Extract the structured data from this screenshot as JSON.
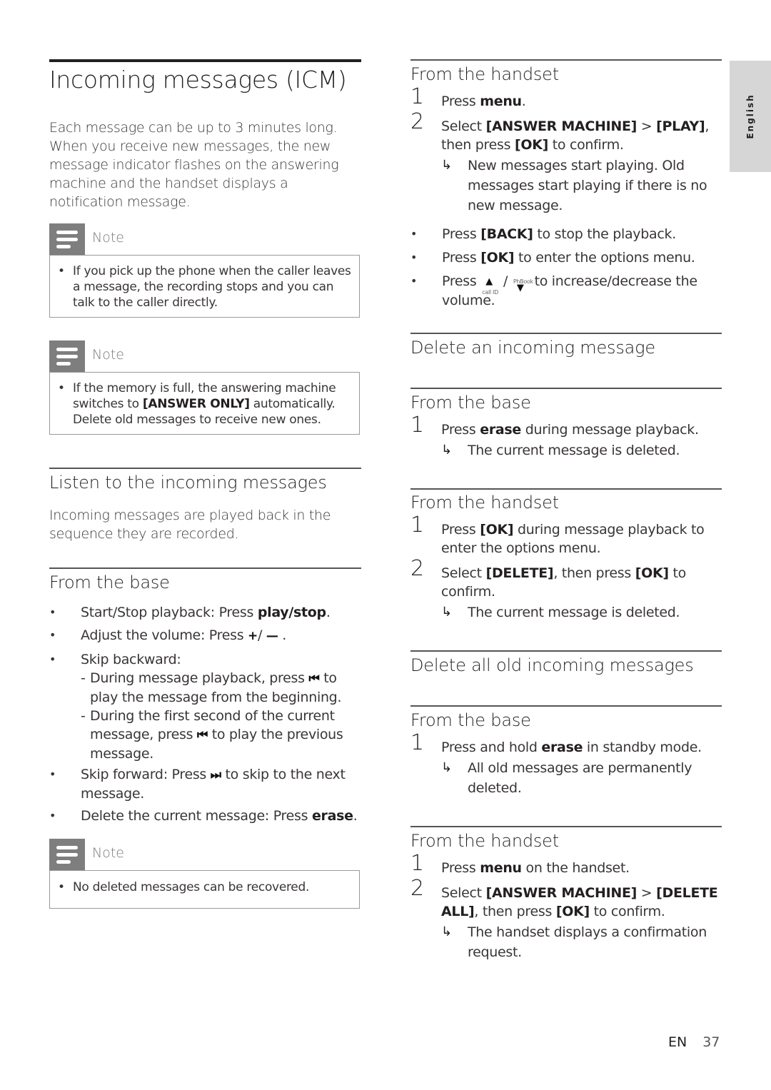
{
  "side_tab": {
    "label": "English"
  },
  "footer": {
    "lang": "EN",
    "page": "37"
  },
  "left": {
    "title": "Incoming messages (ICM)",
    "intro": "Each message can be up to 3 minutes long. When you receive new messages, the new message indicator flashes on the answering machine and the handset displays a notification message.",
    "notes": [
      {
        "label": "Note",
        "items": [
          "If you pick up the phone when the caller leaves a message, the recording stops and you can talk to the caller directly."
        ]
      },
      {
        "label": "Note",
        "items_pre": "If the memory is full, the answering machine switches to ",
        "items_bold": "[ANSWER ONLY]",
        "items_post": " automatically. Delete old messages to receive new ones."
      },
      {
        "label": "Note",
        "items": [
          "No deleted messages can be recovered."
        ]
      }
    ],
    "listen": {
      "heading": "Listen to the incoming messages",
      "text": "Incoming messages are played back in the sequence they are recorded."
    },
    "from_base": {
      "heading": "From the base",
      "bullets": {
        "b1_pre": "Start/Stop playback: Press ",
        "b1_bold": "play/stop",
        "b1_post": ".",
        "b2_pre": "Adjust the volume: Press ",
        "b2_plus": "+",
        "b2_sep": "/ ",
        "b2_minus": "—",
        "b2_post": " .",
        "b3": "Skip backward:",
        "b3_sub1_pre": "During message playback, press ",
        "b3_sub1_icon": "⏮",
        "b3_sub1_post": " to play the message from the beginning.",
        "b3_sub2_pre": "During the first second of the current message, press ",
        "b3_sub2_icon": "⏮",
        "b3_sub2_post": " to play the previous message.",
        "b4_pre": "Skip forward: Press ",
        "b4_icon": "⏭",
        "b4_post": " to skip to the next message.",
        "b5_pre": "Delete the current message: Press ",
        "b5_bold": "erase",
        "b5_post": "."
      }
    }
  },
  "right": {
    "handset1": {
      "heading": "From the handset",
      "s1_pre": "Press ",
      "s1_bold": "menu",
      "s1_post": ".",
      "s2_pre": "Select ",
      "s2_b1": "[ANSWER MACHINE]",
      "s2_mid": " > ",
      "s2_b2": "[PLAY]",
      "s2_mid2": ", then press ",
      "s2_b3": "[OK]",
      "s2_post": " to confirm.",
      "s2_result": "New messages start playing. Old messages start playing if there is no new message.",
      "bullet1_pre": "Press ",
      "bullet1_bold": "[BACK]",
      "bullet1_post": " to stop the playback.",
      "bullet2_pre": "Press ",
      "bullet2_bold": "[OK]",
      "bullet2_post": " to enter the options menu.",
      "bullet3_pre": "Press ",
      "bullet3_up_label": "call ID",
      "bullet3_sep": " / ",
      "bullet3_down_label": "PhBook",
      "bullet3_post": " to increase/decrease the volume."
    },
    "delete_one": {
      "heading": "Delete an incoming message",
      "base_heading": "From the base",
      "base_s1_pre": "Press ",
      "base_s1_bold": "erase",
      "base_s1_post": " during message playback.",
      "base_s1_result": "The current message is deleted.",
      "handset_heading": "From the handset",
      "hs_s1_pre": "Press ",
      "hs_s1_bold": "[OK]",
      "hs_s1_post": " during message playback to enter the options menu.",
      "hs_s2_pre": "Select ",
      "hs_s2_b1": "[DELETE]",
      "hs_s2_mid": ", then press ",
      "hs_s2_b2": "[OK]",
      "hs_s2_post": " to confirm.",
      "hs_s2_result": "The current message is deleted."
    },
    "delete_all": {
      "heading": "Delete all old incoming messages",
      "base_heading": "From the base",
      "base_s1_pre": "Press and hold ",
      "base_s1_bold": "erase",
      "base_s1_post": " in standby mode.",
      "base_s1_result": "All old messages are permanently deleted.",
      "handset_heading": "From the handset",
      "hs_s1_pre": "Press ",
      "hs_s1_bold": "menu",
      "hs_s1_post": " on the handset.",
      "hs_s2_pre": "Select ",
      "hs_s2_b1": "[ANSWER MACHINE]",
      "hs_s2_mid": " > ",
      "hs_s2_b2": "[DELETE ALL]",
      "hs_s2_mid2": ", then press ",
      "hs_s2_b3": "[OK]",
      "hs_s2_post": " to confirm.",
      "hs_s2_result": "The handset displays a confirmation request."
    },
    "step_numbers": [
      "1",
      "2"
    ],
    "bullet_char": "•",
    "arrow_char": "↳"
  }
}
